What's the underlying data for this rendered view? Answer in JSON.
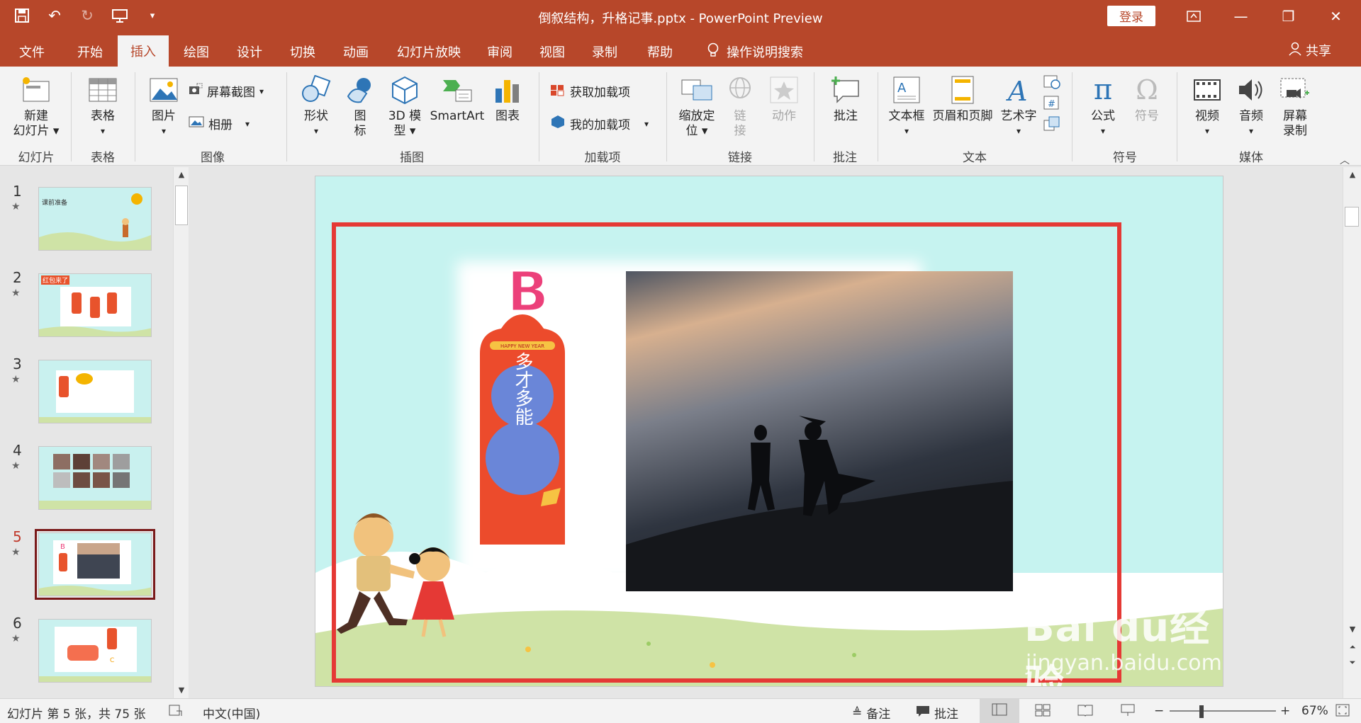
{
  "app": {
    "title": "倒叙结构，升格记事.pptx  -  PowerPoint Preview",
    "login_label": "登录"
  },
  "quick_access": [
    "save-icon",
    "undo-icon",
    "redo-icon",
    "present-icon",
    "customize-icon"
  ],
  "tabs": [
    {
      "label": "文件",
      "active": false
    },
    {
      "label": "开始",
      "active": false
    },
    {
      "label": "插入",
      "active": true
    },
    {
      "label": "绘图",
      "active": false
    },
    {
      "label": "设计",
      "active": false
    },
    {
      "label": "切换",
      "active": false
    },
    {
      "label": "动画",
      "active": false
    },
    {
      "label": "幻灯片放映",
      "active": false
    },
    {
      "label": "审阅",
      "active": false
    },
    {
      "label": "视图",
      "active": false
    },
    {
      "label": "录制",
      "active": false
    },
    {
      "label": "帮助",
      "active": false
    }
  ],
  "tell_me": "操作说明搜索",
  "share_label": "共享",
  "ribbon": {
    "new_slide_l1": "新建",
    "new_slide_l2": "幻灯片",
    "table": "表格",
    "picture": "图片",
    "screenshot": "屏幕截图",
    "album": "相册",
    "shapes": "形状",
    "icons_l1": "图",
    "icons_l2": "标",
    "model3d_l1": "3D 模",
    "model3d_l2": "型",
    "smartart": "SmartArt",
    "chart": "图表",
    "get_addins": "获取加载项",
    "my_addins": "我的加载项",
    "zoom_l1": "缩放定",
    "zoom_l2": "位",
    "link_l1": "链",
    "link_l2": "接",
    "action": "动作",
    "comment": "批注",
    "textbox": "文本框",
    "header_footer": "页眉和页脚",
    "wordart": "艺术字",
    "equation": "公式",
    "symbol": "符号",
    "video": "视频",
    "audio": "音频",
    "screen_rec_l1": "屏幕",
    "screen_rec_l2": "录制"
  },
  "groups": {
    "slides": "幻灯片",
    "tables": "表格",
    "images": "图像",
    "illustrations": "插图",
    "addins": "加载项",
    "links": "链接",
    "comments": "批注",
    "text": "文本",
    "symbols": "符号",
    "media": "媒体"
  },
  "thumbnails": [
    {
      "num": "1",
      "title": "课前准备",
      "selected": false
    },
    {
      "num": "2",
      "title": "红包来了",
      "selected": false
    },
    {
      "num": "3",
      "title": "",
      "selected": false
    },
    {
      "num": "4",
      "title": "",
      "selected": false
    },
    {
      "num": "5",
      "title": "",
      "selected": true
    },
    {
      "num": "6",
      "title": "",
      "selected": false
    }
  ],
  "slide": {
    "badge_letter": "B",
    "envelope_text": "多才多能",
    "envelope_banner": "HAPPY NEW YEAR"
  },
  "watermark": {
    "brand": "Bai du经验",
    "url": "jingyan.baidu.com"
  },
  "status": {
    "slide_info": "幻灯片 第 5 张，共 75 张",
    "language": "中文(中国)",
    "notes": "备注",
    "comments": "批注",
    "zoom": "67%"
  },
  "colors": {
    "accent": "#b7472a",
    "slide_bg": "#c6f3f0",
    "highlight_box": "#e53935"
  }
}
